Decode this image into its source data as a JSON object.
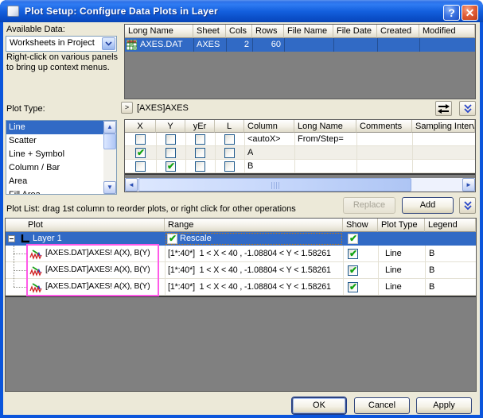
{
  "window": {
    "title": "Plot Setup: Configure Data Plots in Layer",
    "help": "?",
    "close": "✕"
  },
  "colors": {
    "selection": "#316AC5",
    "titlebar_blue": "#1460DE",
    "filler_gray": "#808080",
    "highlight_pink": "#FF5AE8",
    "check_green": "#12A312"
  },
  "available_data": {
    "label": "Available Data:",
    "value": "Worksheets in Project",
    "hint1": "Right-click on various panels",
    "hint2": "to bring up context menus."
  },
  "plot_type": {
    "label": "Plot Type:",
    "items": [
      "Line",
      "Scatter",
      "Line + Symbol",
      "Column / Bar",
      "Area",
      "Fill Area"
    ],
    "selected": "Line"
  },
  "data_table": {
    "columns": [
      "Long Name",
      "Sheet",
      "Cols",
      "Rows",
      "File Name",
      "File Date",
      "Created",
      "Modified"
    ],
    "row": {
      "long_name": "AXES.DAT",
      "sheet": "AXES",
      "cols": "2",
      "rows": "60",
      "file_name": "",
      "file_date": "",
      "created": "",
      "modified": ""
    }
  },
  "sheet_band": {
    "expand": ">",
    "label": "[AXES]AXES"
  },
  "columns_table": {
    "columns": [
      "X",
      "Y",
      "yEr",
      "L",
      "Column",
      "Long Name",
      "Comments",
      "Sampling Interval"
    ],
    "rows": [
      {
        "x": false,
        "y": false,
        "yer": false,
        "l": false,
        "column": "<autoX>",
        "long_name": "From/Step=",
        "comments": "",
        "sampling_interval": ""
      },
      {
        "x": true,
        "y": false,
        "yer": false,
        "l": false,
        "column": "A",
        "long_name": "",
        "comments": "",
        "sampling_interval": ""
      },
      {
        "x": false,
        "y": true,
        "yer": false,
        "l": false,
        "column": "B",
        "long_name": "",
        "comments": "",
        "sampling_interval": ""
      }
    ]
  },
  "actions": {
    "replace": "Replace",
    "add": "Add"
  },
  "plot_list": {
    "caption": "Plot List: drag 1st column to reorder plots, or right click for other operations",
    "columns": [
      "Plot",
      "Range",
      "Show",
      "Plot Type",
      "Legend"
    ],
    "layer": {
      "label": "Layer 1",
      "range": "Rescale",
      "rescale_checked": true,
      "show_checked": true
    },
    "rows": [
      {
        "plot": "[AXES.DAT]AXES! A(X), B(Y)",
        "range": "[1*:40*]  1 < X < 40 , -1.08804 < Y < 1.58261",
        "show": true,
        "plot_type": "Line",
        "legend": "B"
      },
      {
        "plot": "[AXES.DAT]AXES! A(X), B(Y)",
        "range": "[1*:40*]  1 < X < 40 , -1.08804 < Y < 1.58261",
        "show": true,
        "plot_type": "Line",
        "legend": "B"
      },
      {
        "plot": "[AXES.DAT]AXES! A(X), B(Y)",
        "range": "[1*:40*]  1 < X < 40 , -1.08804 < Y < 1.58261",
        "show": true,
        "plot_type": "Line",
        "legend": "B"
      }
    ]
  },
  "footer": {
    "ok": "OK",
    "cancel": "Cancel",
    "apply": "Apply"
  },
  "icons": {
    "window_icon": "window",
    "help_icon": "?",
    "close_icon": "x",
    "combo_arrow_icon": "chevron-down",
    "expand_panel_icon": ">",
    "swap_columns_icon": "swap-arrows",
    "expand_more_icon": "double-chevron-down",
    "worksheet_icon": "grid",
    "layer_icon": "L",
    "plot_curve_icon": "red-wave",
    "tree_collapse_icon": "minus",
    "check_icon": "check",
    "scroll_icons": "arrows"
  }
}
